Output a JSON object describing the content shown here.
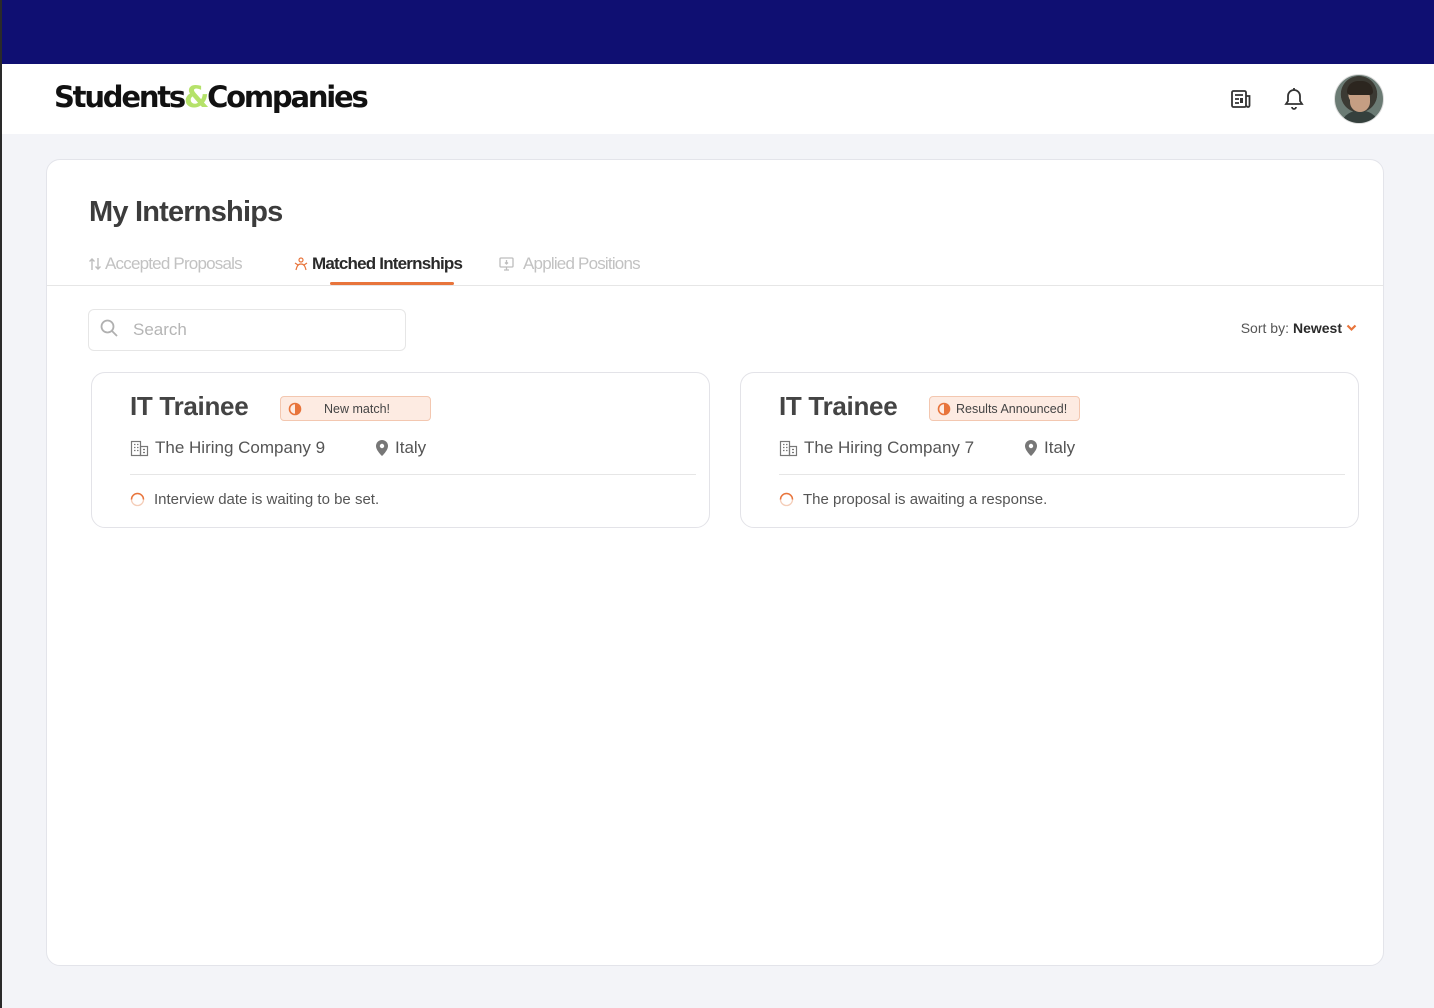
{
  "app": {
    "logo_part1": "Students",
    "logo_amp": "&",
    "logo_part2": "Companies",
    "accent_color": "#e8743b",
    "topbar_color": "#0f0f72",
    "logo_amp_color": "#b5e26a"
  },
  "header": {
    "icons": [
      "news-icon",
      "bell-icon"
    ],
    "avatar": "user-avatar"
  },
  "main": {
    "title": "My Internships",
    "tabs": [
      {
        "label": "Accepted Proposals",
        "icon": "swap-arrows-icon",
        "active": false
      },
      {
        "label": "Matched Internships",
        "icon": "match-icon",
        "active": true
      },
      {
        "label": "Applied Positions",
        "icon": "applied-icon",
        "active": false
      }
    ],
    "search": {
      "placeholder": "Search",
      "value": ""
    },
    "sort": {
      "label": "Sort by:",
      "value": "Newest"
    },
    "cards": [
      {
        "title": "IT Trainee",
        "badge": "New match!",
        "company": "The Hiring Company 9",
        "location": "Italy",
        "status": "Interview date is waiting to be set."
      },
      {
        "title": "IT Trainee",
        "badge": "Results Announced!",
        "company": "The Hiring Company 7",
        "location": "Italy",
        "status": "The proposal is awaiting a response."
      }
    ]
  }
}
